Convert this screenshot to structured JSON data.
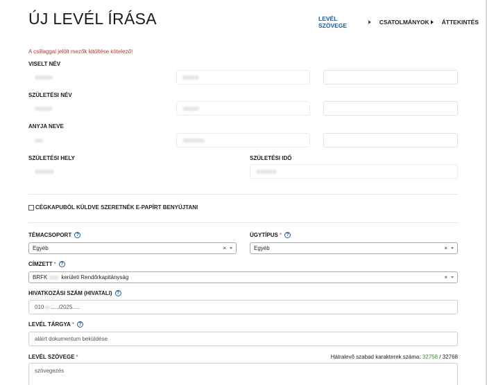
{
  "page": {
    "title": "ÚJ LEVÉL ÍRÁSA",
    "required_note": "A csillaggal jelölt mezők kitöltése kötelező!"
  },
  "steps": [
    {
      "label": "LEVÉL SZÖVEGE"
    },
    {
      "label": "CSATOLMÁNYOK"
    },
    {
      "label": "ÁTTEKINTÉS"
    }
  ],
  "labels": {
    "viselt_nev": "VISELT NÉV",
    "szuletesi_nev": "SZÜLETÉSI NÉV",
    "anyja_neve": "ANYJA NEVE",
    "szuletesi_hely": "SZÜLETÉSI HELY",
    "szuletesi_ido": "SZÜLETÉSI IDŐ",
    "cegkapu": "CÉGKAPUBÓL KÜLDVE SZERETNÉK E-PAPÍRT BENYÚJTANI",
    "temacsoport": "TÉMACSOPORT",
    "ugytipus": "ÜGYTÍPUS",
    "cimzett": "CÍMZETT",
    "hivatkozasi_szam": "HIVATKOZÁSI SZÁM (HIVATALI)",
    "level_targya": "LEVÉL TÁRGYA",
    "level_szovege": "LEVÉL SZÖVEGE",
    "required_mark": "*",
    "help_mark": "?"
  },
  "fields": {
    "temacsoport_value": "Egyéb",
    "ugytipus_value": "Egyéb",
    "cimzett_value_prefix": "BRFK",
    "cimzett_value_suffix": "kerületi Rendőrkapitányság",
    "hivatkozasi_prefix": "010",
    "hivatkozasi_suffix": "...../2025.....",
    "level_targya_value": "aláírt dokumentum beküldése",
    "level_szovege_value": "szövegezés",
    "clear_symbol": "×"
  },
  "counter": {
    "label": "Hátralevő szabad karakterek száma:",
    "remaining": "32758",
    "separator": "/",
    "max": "32768"
  }
}
